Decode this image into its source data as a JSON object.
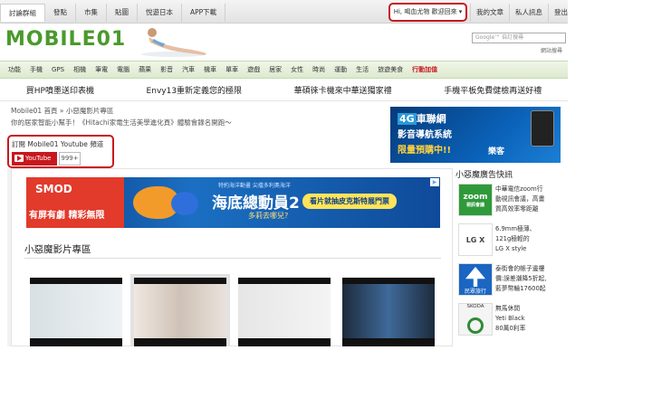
{
  "topnav": {
    "items": [
      "討論群組",
      "發點",
      "市集",
      "貼圖",
      "悅遊日本",
      "APP下載"
    ],
    "user_greeting": "Hi, 喝血尤物 歡迎回來 ▾",
    "right_links": [
      "我的文章",
      "私人訊息",
      "登出"
    ]
  },
  "header": {
    "logo_text": "MOBILE01",
    "search_placeholder": "Google™ 自訂搜尋",
    "search_link": "網站搜尋"
  },
  "category_nav": {
    "items": [
      "功能",
      "手機",
      "GPS",
      "相機",
      "筆電",
      "電腦",
      "蘋果",
      "影音",
      "汽車",
      "機車",
      "單車",
      "遊戲",
      "居家",
      "女性",
      "時尚",
      "運動",
      "生活",
      "旅遊美食",
      "行動加值"
    ]
  },
  "promo_links": [
    "買HP噴墨送印表機",
    "Envy13重新定義您的極限",
    "華碩徠卡機來中華送獨家禮",
    "手機平板免費健檢再送好禮"
  ],
  "breadcrumb": "Mobile01 首頁 » 小惡魔影片專區",
  "subtitle": "你的居家智能小幫手！《Hitachi家電生活美學進化頁》體驗會錄名開跑～",
  "subscribe": {
    "title": "訂閱 Mobile01 Youtube 頻道",
    "button_label": "YouTube",
    "count": "999+"
  },
  "top_banner": {
    "line1_prefix": "4G",
    "line1": "車聯網",
    "line2": "影音導航系統",
    "line3": "限量預購中!!",
    "brand": "樂客"
  },
  "big_ad": {
    "brand": "SMOD",
    "slogan": "有屏有劇 精彩無限",
    "presenter": "特約海洋動畫 尖擋多利奧海洋",
    "movie_title": "海底總動員2",
    "movie_sub": "多莉去哪兒?",
    "cta": "看片就抽皮克斯特展門票"
  },
  "section_title": "小惡魔影片專區",
  "right_column": {
    "title": "小惡魔廣告快訊",
    "items": [
      {
        "icon_text": "zoom",
        "icon_sub": "視訊會議",
        "lines": [
          "中華電信zoom行",
          "動視訊會議，高畫",
          "質高效率零距離"
        ]
      },
      {
        "icon_text": "LG X style",
        "lines": [
          "6.9mm極薄、",
          "121g極輕的",
          "LG X style"
        ]
      },
      {
        "icon_text": "民眾旅行",
        "lines": [
          "泰街會的帳子邊樓",
          "價:誤差潮降5折起,",
          "藍夢幣輪17600起"
        ]
      },
      {
        "icon_text": "ŠKODA",
        "lines": [
          "無馬休閒",
          "Yeti Black",
          "80萬0利率"
        ]
      }
    ]
  }
}
